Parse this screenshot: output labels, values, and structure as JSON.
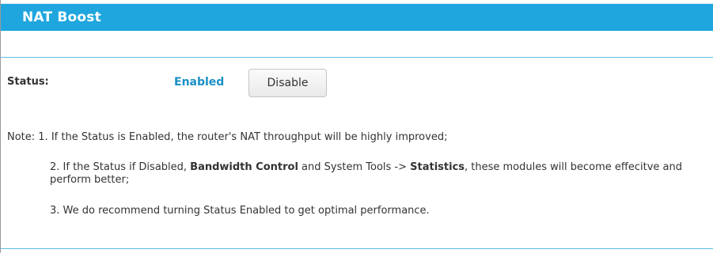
{
  "header": {
    "title": "NAT Boost"
  },
  "status": {
    "label": "Status:",
    "value": "Enabled",
    "button_label": "Disable"
  },
  "notes": {
    "line1": "Note: 1. If the Status is Enabled, the router's NAT throughput will be highly improved;",
    "line2": {
      "part1": "2. If the Status if Disabled, ",
      "bold1": "Bandwidth Control",
      "part2": " and System Tools -> ",
      "bold2": "Statistics",
      "part3": ", these modules will become effecitve and perform better;"
    },
    "line3": "3. We do recommend turning Status Enabled to get optimal performance."
  },
  "colors": {
    "header_bg": "#1fa6de",
    "accent_text": "#1a8fc6",
    "divider": "#5fbde6"
  }
}
